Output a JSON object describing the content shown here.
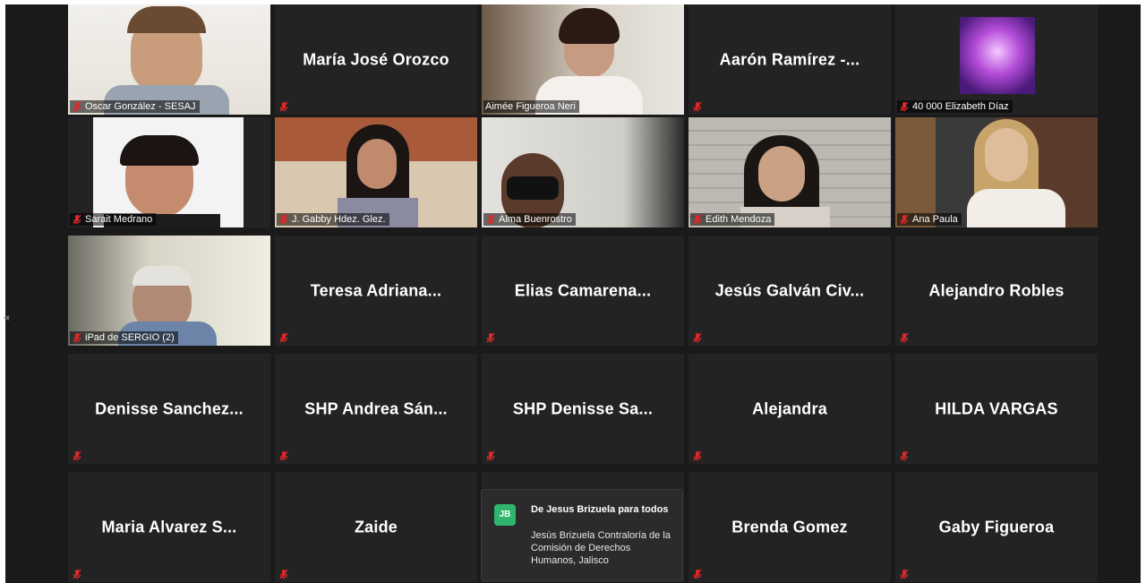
{
  "participants": [
    {
      "name": "Oscar González - SESAJ",
      "display": "",
      "video": true,
      "scene": "man"
    },
    {
      "name": "",
      "display": "María José Orozco",
      "video": false
    },
    {
      "name": "Aimée Figueroa Neri",
      "display": "",
      "video": true,
      "scene": "office",
      "speaking": true
    },
    {
      "name": "",
      "display": "Aarón Ramírez -...",
      "video": false
    },
    {
      "name": "40 000 Elizabeth Díaz",
      "display": "",
      "video": false,
      "scene": "avatar"
    },
    {
      "name": "Sarait Medrano",
      "display": "",
      "video": true,
      "scene": "woman1"
    },
    {
      "name": "J. Gabby Hdez. Glez.",
      "display": "",
      "video": true,
      "scene": "woman2"
    },
    {
      "name": "Alma Buenrostro",
      "display": "",
      "video": true,
      "scene": "woman3"
    },
    {
      "name": "Edith Mendoza",
      "display": "",
      "video": true,
      "scene": "woman4"
    },
    {
      "name": "Ana Paula",
      "display": "",
      "video": true,
      "scene": "woman5"
    },
    {
      "name": "iPad de SERGIO (2)",
      "display": "",
      "video": true,
      "scene": "man2"
    },
    {
      "name": "",
      "display": "Teresa Adriana...",
      "video": false
    },
    {
      "name": "",
      "display": "Elias Camarena...",
      "video": false
    },
    {
      "name": "",
      "display": "Jesús Galván Civ...",
      "video": false
    },
    {
      "name": "",
      "display": "Alejandro Robles",
      "video": false
    },
    {
      "name": "",
      "display": "Denisse Sanchez...",
      "video": false
    },
    {
      "name": "",
      "display": "SHP Andrea Sán...",
      "video": false
    },
    {
      "name": "",
      "display": "SHP Denisse Sa...",
      "video": false
    },
    {
      "name": "",
      "display": "Alejandra",
      "video": false
    },
    {
      "name": "",
      "display": "HILDA VARGAS",
      "video": false
    },
    {
      "name": "",
      "display": "Maria Alvarez S...",
      "video": false
    },
    {
      "name": "",
      "display": "Zaide",
      "video": false
    },
    {
      "name": "",
      "display": "",
      "video": false,
      "hidden_by_chat": true
    },
    {
      "name": "",
      "display": "Brenda Gomez",
      "video": false
    },
    {
      "name": "",
      "display": "Gaby Figueroa",
      "video": false
    }
  ],
  "chat_toast": {
    "initials": "JB",
    "from": "De Jesus Brizuela para todos",
    "message": "Jesús Brizuela Contraloría de la Comisión de Derechos Humanos, Jalisco"
  },
  "colors": {
    "background": "#1a1a1a",
    "tile": "#232323",
    "active_speaker": "#a6d43a",
    "muted": "#e02828",
    "chat_avatar": "#2fb56d"
  },
  "icons": {
    "muted": "mic-muted-icon"
  }
}
